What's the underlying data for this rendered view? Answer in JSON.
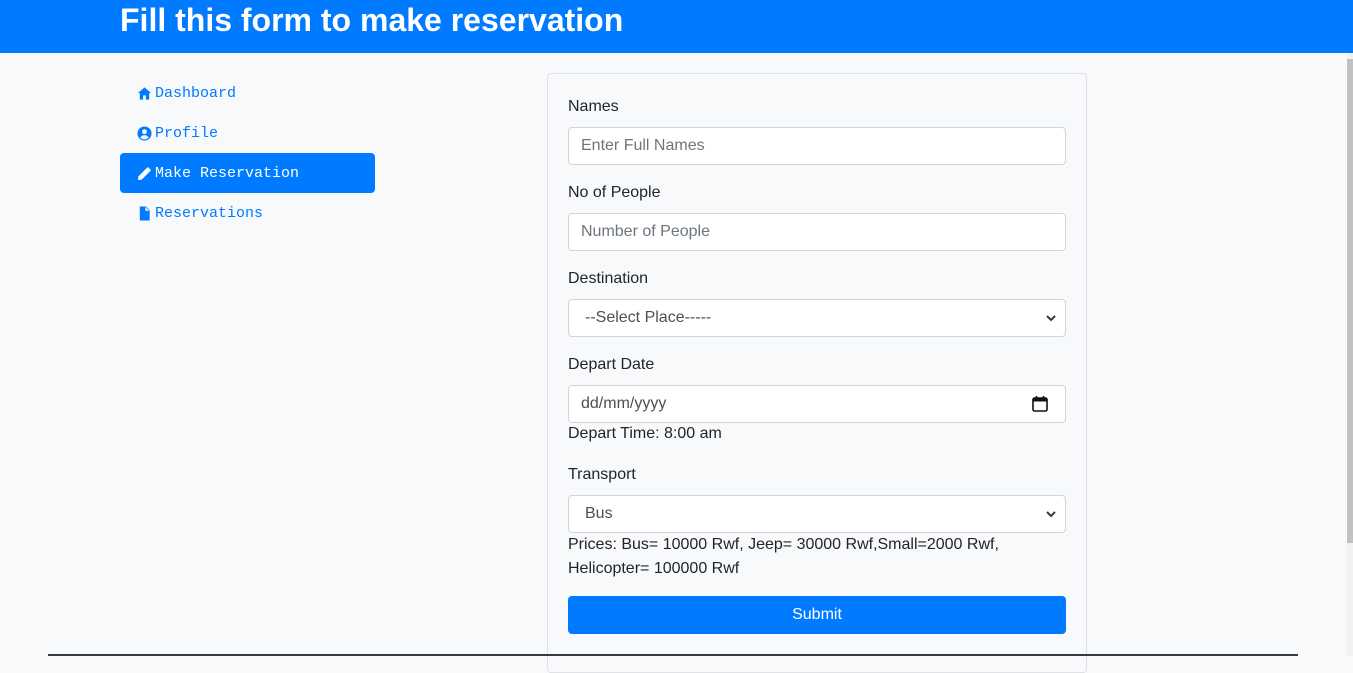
{
  "header": {
    "title": "Fill this form to make reservation"
  },
  "sidebar": {
    "items": [
      {
        "label": "Dashboard",
        "icon": "home-icon",
        "active": false
      },
      {
        "label": "Profile",
        "icon": "user-circle-icon",
        "active": false
      },
      {
        "label": "Make Reservation",
        "icon": "pencil-icon",
        "active": true
      },
      {
        "label": "Reservations",
        "icon": "file-icon",
        "active": false
      }
    ]
  },
  "form": {
    "names": {
      "label": "Names",
      "placeholder": "Enter Full Names"
    },
    "people": {
      "label": "No of People",
      "placeholder": "Number of People"
    },
    "destination": {
      "label": "Destination",
      "selected": "--Select Place-----"
    },
    "depart_date": {
      "label": "Depart Date",
      "placeholder": "dd/mm/yyyy"
    },
    "depart_time": "Depart Time: 8:00 am",
    "transport": {
      "label": "Transport",
      "selected": "Bus"
    },
    "prices_line1": "Prices: Bus= 10000 Rwf, Jeep= 30000 Rwf,Small=2000 Rwf,",
    "prices_line2": "Helicopter= 100000 Rwf",
    "submit_label": "Submit"
  },
  "colors": {
    "primary": "#007bff",
    "background": "#f8f9fa"
  }
}
